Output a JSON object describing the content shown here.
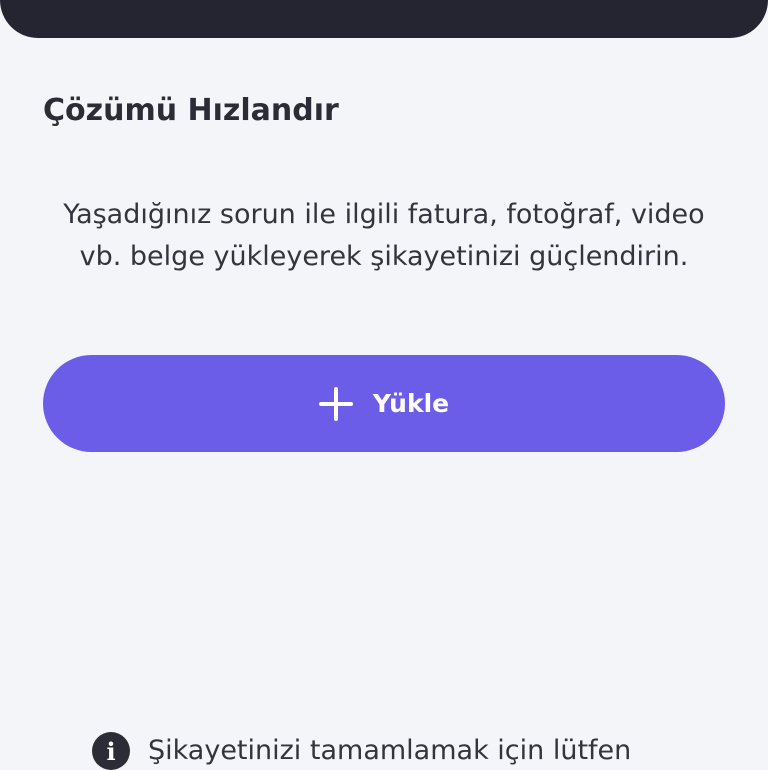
{
  "section": {
    "title": "Çözümü Hızlandır",
    "description": "Yaşadığınız sorun ile ilgili fatura, fotoğraf, video vb. belge yükleyerek şikayetinizi güçlendirin."
  },
  "upload_button": {
    "label": "Yükle",
    "icon": "plus-icon"
  },
  "notice": {
    "icon": "info-icon",
    "text": "Şikayetinizi tamamlamak için lütfen"
  },
  "colors": {
    "background": "#f4f5f9",
    "top_card": "#252531",
    "accent": "#6b5de8",
    "text": "#2c2c36"
  }
}
